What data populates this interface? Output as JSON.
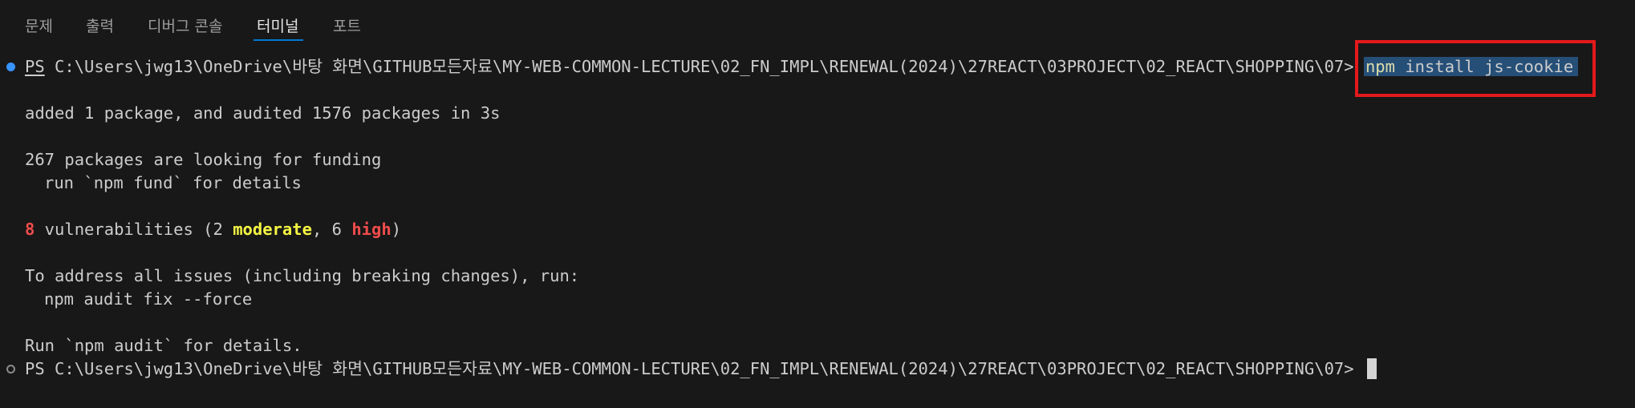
{
  "panel": {
    "tabs": [
      {
        "label": "문제"
      },
      {
        "label": "출력"
      },
      {
        "label": "디버그 콘솔"
      },
      {
        "label": "터미널"
      },
      {
        "label": "포트"
      }
    ],
    "active_tab": "터미널"
  },
  "terminal": {
    "prompt_ps": "PS",
    "prompt_path": " C:\\Users\\jwg13\\OneDrive\\바탕 화면\\GITHUB모든자료\\MY-WEB-COMMON-LECTURE\\02_FN_IMPL\\RENEWAL(2024)\\27REACT\\03PROJECT\\02_REACT\\SHOPPING\\07> ",
    "command_bin": "npm",
    "command_args": " install js-cookie",
    "output": {
      "added": "added 1 package, and audited 1576 packages in 3s",
      "funding": "267 packages are looking for funding",
      "fund_hint": "run `npm fund` for details",
      "vuln_count": "8",
      "vuln_text_1": " vulnerabilities (2 ",
      "vuln_moderate": "moderate",
      "vuln_text_2": ", 6 ",
      "vuln_high": "high",
      "vuln_text_3": ")",
      "address": "To address all issues (including breaking changes), run:",
      "fix_cmd": "npm audit fix --force",
      "audit_hint": "Run `npm audit` for details."
    },
    "prompt2_ps": "PS",
    "prompt2_path": " C:\\Users\\jwg13\\OneDrive\\바탕 화면\\GITHUB모든자료\\MY-WEB-COMMON-LECTURE\\02_FN_IMPL\\RENEWAL(2024)\\27REACT\\03PROJECT\\02_REACT\\SHOPPING\\07> "
  },
  "colors": {
    "background": "#181818",
    "text": "#cccccc",
    "selection": "#264f78",
    "annotation": "#e3191c",
    "accent": "#0078d4"
  }
}
